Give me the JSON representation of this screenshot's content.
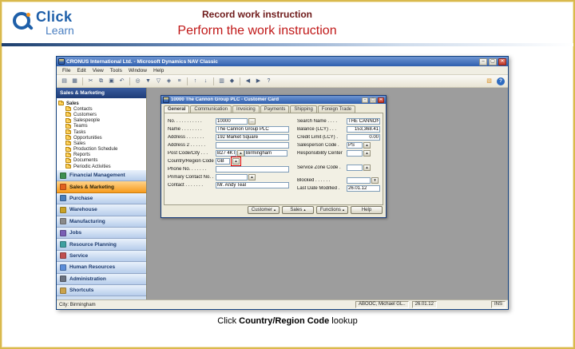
{
  "colors": {
    "frame_gold": "#D9B94D",
    "title_maroon": "#6E1A1A",
    "subtitle_red": "#C01818",
    "titlebar_blue": "#2F5FAE",
    "nav_active_orange": "#F79B1D",
    "highlight_red": "#E00000",
    "workspace_gray": "#9D9D9D"
  },
  "header": {
    "logo_click": "Click",
    "logo_learn": "Learn",
    "title": "Record work instruction",
    "subtitle": "Perform the work instruction"
  },
  "app": {
    "window_title": "CRONUS International Ltd. - Microsoft Dynamics NAV Classic",
    "window_buttons": {
      "minimize": "–",
      "maximize": "▢",
      "close": "✕"
    },
    "menu": [
      "File",
      "Edit",
      "View",
      "Tools",
      "Window",
      "Help"
    ],
    "toolbar_icons": [
      {
        "name": "new-icon",
        "glyph": "▤"
      },
      {
        "name": "print-icon",
        "glyph": "▦"
      },
      {
        "name": "cut-icon",
        "glyph": "✂"
      },
      {
        "name": "copy-icon",
        "glyph": "⧉"
      },
      {
        "name": "paste-icon",
        "glyph": "▣"
      },
      {
        "name": "undo-icon",
        "glyph": "↶"
      },
      {
        "name": "find-icon",
        "glyph": "◎"
      },
      {
        "name": "field-filter-icon",
        "glyph": "▼"
      },
      {
        "name": "table-filter-icon",
        "glyph": "▽"
      },
      {
        "name": "flow-filter-icon",
        "glyph": "◈"
      },
      {
        "name": "show-all-icon",
        "glyph": "≡"
      },
      {
        "name": "sort-ascending-icon",
        "glyph": "↑"
      },
      {
        "name": "sort-descending-icon",
        "glyph": "↓"
      },
      {
        "name": "list-icon",
        "glyph": "▥"
      },
      {
        "name": "navigate-icon",
        "glyph": "◆"
      },
      {
        "name": "previous-icon",
        "glyph": "◀"
      },
      {
        "name": "next-icon",
        "glyph": "▶"
      },
      {
        "name": "help-icon",
        "glyph": "?"
      }
    ],
    "toolbar_right": [
      {
        "name": "export-icon",
        "glyph": "▧"
      },
      {
        "name": "help-circle-icon",
        "glyph": "?"
      }
    ],
    "pane_header": "Sales & Marketing",
    "tree": [
      "Sales",
      "Contacts",
      "Customers",
      "Salespeople",
      "Teams",
      "Tasks",
      "Opportunities",
      "Sales",
      "Production Schedule",
      "Reports",
      "Documents",
      "Periodic Activities"
    ],
    "nav_buttons": [
      "Financial Management",
      "Sales & Marketing",
      "Purchase",
      "Warehouse",
      "Manufacturing",
      "Jobs",
      "Resource Planning",
      "Service",
      "Human Resources",
      "Administration",
      "Shortcuts"
    ],
    "active_nav": "Sales & Marketing",
    "statusbar": {
      "left": "City: Birmingham",
      "user": "ABOOC, Michael GL..",
      "date": "26.01.12",
      "mode": "INS"
    }
  },
  "dialog": {
    "title": "10000 The Cannon Group PLC - Customer Card",
    "tabs": [
      "General",
      "Communication",
      "Invoicing",
      "Payments",
      "Shipping",
      "Foreign Trade"
    ],
    "active_tab": "General",
    "lookup_glyph": "▲",
    "assist_glyph": "…",
    "dropdown_glyph": "▼",
    "menu_arrow": "▴",
    "left_fields": [
      {
        "label": "No. . . . . . . . . . .",
        "value": "10000"
      },
      {
        "label": "Name  . . . . . . . .",
        "value": "The Cannon Group PLC"
      },
      {
        "label": "Address . . . . . . .",
        "value": "192 Market Square"
      },
      {
        "label": "Address 2 . . . . . .",
        "value": ""
      },
      {
        "label": "Post Code/City  . . .",
        "value": "B27 4KT",
        "value2": "Birmingham"
      },
      {
        "label": "Country/Region Code .",
        "value": "GB"
      },
      {
        "label": "Phone No. . . . . . .",
        "value": ""
      },
      {
        "label": "Primary Contact No. .",
        "value": ""
      },
      {
        "label": "Contact . . . . . . .",
        "value": "Mr. Andy Teal"
      }
    ],
    "right_fields": [
      {
        "label": "Search Name . . . .",
        "value": "THE CANNON GR..."
      },
      {
        "label": "Balance (LCY) . . .",
        "value": "153,368.41"
      },
      {
        "label": "Credit Limit (LCY) .",
        "value": "0.00"
      },
      {
        "label": "Salesperson Code  .",
        "value": "PS"
      },
      {
        "label": "Responsibility Center",
        "value": ""
      },
      {
        "label": "Service Zone Code .",
        "value": ""
      },
      {
        "label": "Blocked . . . . . .",
        "value": ""
      },
      {
        "label": "Last Date Modified .",
        "value": "26.01.12"
      }
    ],
    "buttons": [
      "Customer",
      "Sales",
      "Functions",
      "Help"
    ]
  },
  "caption": {
    "pre": "Click ",
    "bold": "Country/Region Code",
    "post": " lookup"
  }
}
